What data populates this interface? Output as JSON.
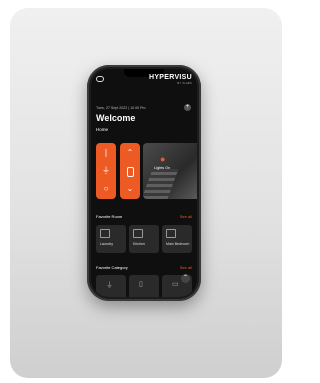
{
  "app": {
    "brand": "HYPERVISU",
    "brand_sub": "BY XLABS",
    "date": "Tues, 27 Sept 2022 | 10.00 Pm",
    "welcome": "Welcome",
    "home": "Home"
  },
  "controls": {
    "col1": [
      "❘",
      "⌖",
      "○"
    ],
    "col2": [
      "⌃",
      "▭",
      "⌄"
    ],
    "scene_label": "Lights On"
  },
  "rooms": {
    "title": "Favorite Room",
    "see_all": "See all",
    "items": [
      {
        "label": "Laundry"
      },
      {
        "label": "Kitchen"
      },
      {
        "label": "Main Bedroom"
      }
    ]
  },
  "categories": {
    "title": "Favorite Category",
    "see_all": "See all"
  },
  "colors": {
    "accent": "#ee5a24",
    "background": "#0f0f0f"
  }
}
